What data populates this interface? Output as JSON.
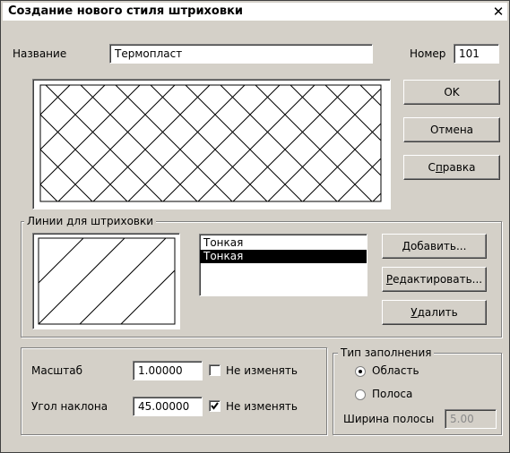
{
  "window": {
    "title": "Создание нового стиля штриховки",
    "close_glyph": "✕"
  },
  "name": {
    "label": "Название",
    "value": "Термопласт"
  },
  "number": {
    "label": "Номер",
    "value": "101"
  },
  "buttons": {
    "ok": "OK",
    "cancel": "Отмена",
    "help_before": "С",
    "help_mnemonic": "п",
    "help_after": "равка"
  },
  "lines_group": {
    "title": "Линии для штриховки",
    "items": [
      "Тонкая",
      "Тонкая"
    ],
    "selected_index": 1,
    "add_mnemonic": "Д",
    "add_rest": "обавить...",
    "edit_mnemonic": "Р",
    "edit_rest": "едактировать...",
    "delete_mnemonic": "У",
    "delete_rest": "далить"
  },
  "scale": {
    "label": "Масштаб",
    "value": "1.00000",
    "keep_label": "Не изменять",
    "keep_checked": false
  },
  "angle": {
    "label": "Угол наклона",
    "value": "45.00000",
    "keep_label": "Не изменять",
    "keep_checked": true
  },
  "fill_type": {
    "title": "Тип заполнения",
    "option_area": "Область",
    "option_strip": "Полоса",
    "selected": "Область",
    "strip_width_label": "Ширина полосы",
    "strip_width_value": "5.00"
  },
  "icons": {
    "check": "check-icon",
    "radio": "radio-icon"
  }
}
